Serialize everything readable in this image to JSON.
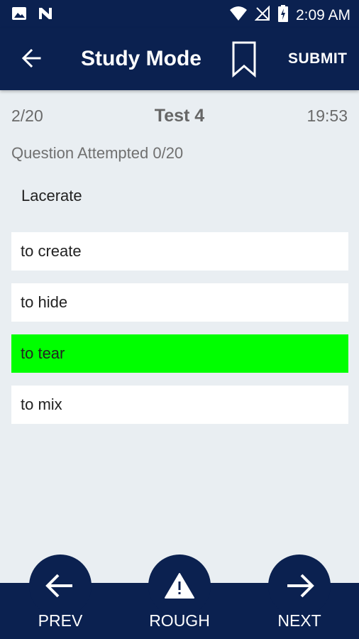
{
  "status_bar": {
    "time": "2:09 AM"
  },
  "app_bar": {
    "title": "Study Mode",
    "submit_label": "SUBMIT"
  },
  "meta": {
    "progress": "2/20",
    "test_name": "Test 4",
    "timer": "19:53"
  },
  "attempted": "Question Attempted 0/20",
  "question": "Lacerate",
  "options": [
    {
      "label": "to create",
      "selected": false
    },
    {
      "label": "to hide",
      "selected": false
    },
    {
      "label": "to tear",
      "selected": true
    },
    {
      "label": "to mix",
      "selected": false
    }
  ],
  "colors": {
    "primary": "#0b2150",
    "selected": "#00ff00",
    "background": "#e9eef2"
  },
  "bottom_nav": {
    "prev_label": "PREV",
    "rough_label": "ROUGH",
    "next_label": "NEXT"
  }
}
